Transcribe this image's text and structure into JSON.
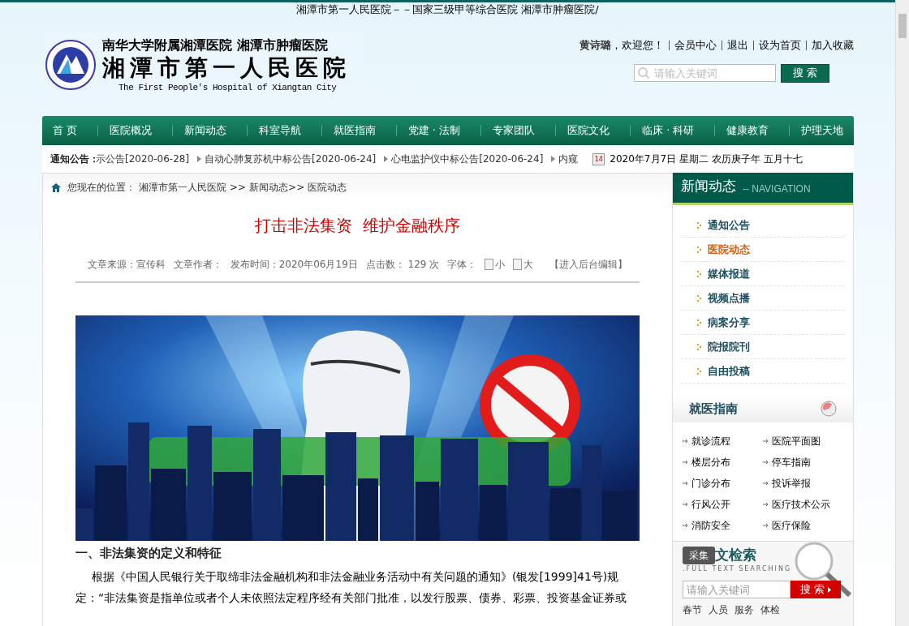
{
  "tagline": "湘潭市第一人民医院－－国家三级甲等综合医院 湘潭市肿瘤医院/",
  "logo": {
    "line1": "南华大学附属湘潭医院  湘潭市肿瘤医院",
    "line2": "湘潭市第一人民医院",
    "english": "The First People's Hospital of Xiangtan City"
  },
  "user_bar": {
    "name": "黄诗璐",
    "greeting": "，欢迎您！",
    "links": [
      "会员中心",
      "退出",
      "设为首页",
      "加入收藏"
    ]
  },
  "top_search": {
    "placeholder": "请输入关键词",
    "button": "搜 索"
  },
  "nav": [
    "首 页",
    "医院概况",
    "新闻动态",
    "科室导航",
    "就医指南",
    "党建 · 法制",
    "专家团队",
    "医院文化",
    "临床 · 科研",
    "健康教育",
    "护理天地"
  ],
  "notice": {
    "label": "通知公告：",
    "first": "示公告[2020-06-28]",
    "items": [
      "自动心肺复苏机中标公告[2020-06-24]",
      "心电监护仪中标公告[2020-06-24]",
      "内窥"
    ],
    "calendar_day": "14",
    "date": "2020年7月7日 星期二 农历庚子年 五月十七"
  },
  "breadcrumb": {
    "label": "您现在的位置：",
    "items": [
      "湘潭市第一人民医院",
      ">>",
      "新闻动态>>",
      "医院动态"
    ]
  },
  "article": {
    "title": "打击非法集资  维护金融秩序",
    "meta": [
      "文章来源：宣传科",
      "文章作者：",
      "发布时间：2020年06月19日",
      "点击数： 129 次",
      "字体："
    ],
    "font_sizes": [
      "小",
      "大"
    ],
    "edit_link": "【进入后台编辑】",
    "heading": "一、非法集资的定义和特征",
    "paragraph": "根据《中国人民银行关于取缔非法金融机构和非法金融业务活动中有关问题的通知》(银发[1999]41号)规定：“非法集资是指单位或者个人未依照法定程序经有关部门批准，以发行股票、债券、彩票、投资基金证券或"
  },
  "side_nav": {
    "title": "新闻动态",
    "subtitle": "-- NAVIGATION",
    "items": [
      {
        "label": "通知公告",
        "selected": false
      },
      {
        "label": "医院动态",
        "selected": true
      },
      {
        "label": "媒体报道",
        "selected": false
      },
      {
        "label": "视频点播",
        "selected": false
      },
      {
        "label": "病案分享",
        "selected": false
      },
      {
        "label": "院报院刊",
        "selected": false
      },
      {
        "label": "自由投稿",
        "selected": false
      }
    ]
  },
  "guide": {
    "title": "就医指南",
    "links": [
      "就诊流程",
      "医院平面图",
      "楼层分布",
      "停车指南",
      "门诊分布",
      "投诉举报",
      "行风公开",
      "医疗技术公示",
      "消防安全",
      "医疗保险"
    ]
  },
  "fulltext": {
    "overlay": "采集",
    "title": "文检索",
    "subtitle": ".FULL TEXT SEARCHING",
    "placeholder": "请输入关键词",
    "button": "搜 索",
    "keywords": [
      "春节",
      "人员",
      "服务",
      "体检"
    ]
  }
}
